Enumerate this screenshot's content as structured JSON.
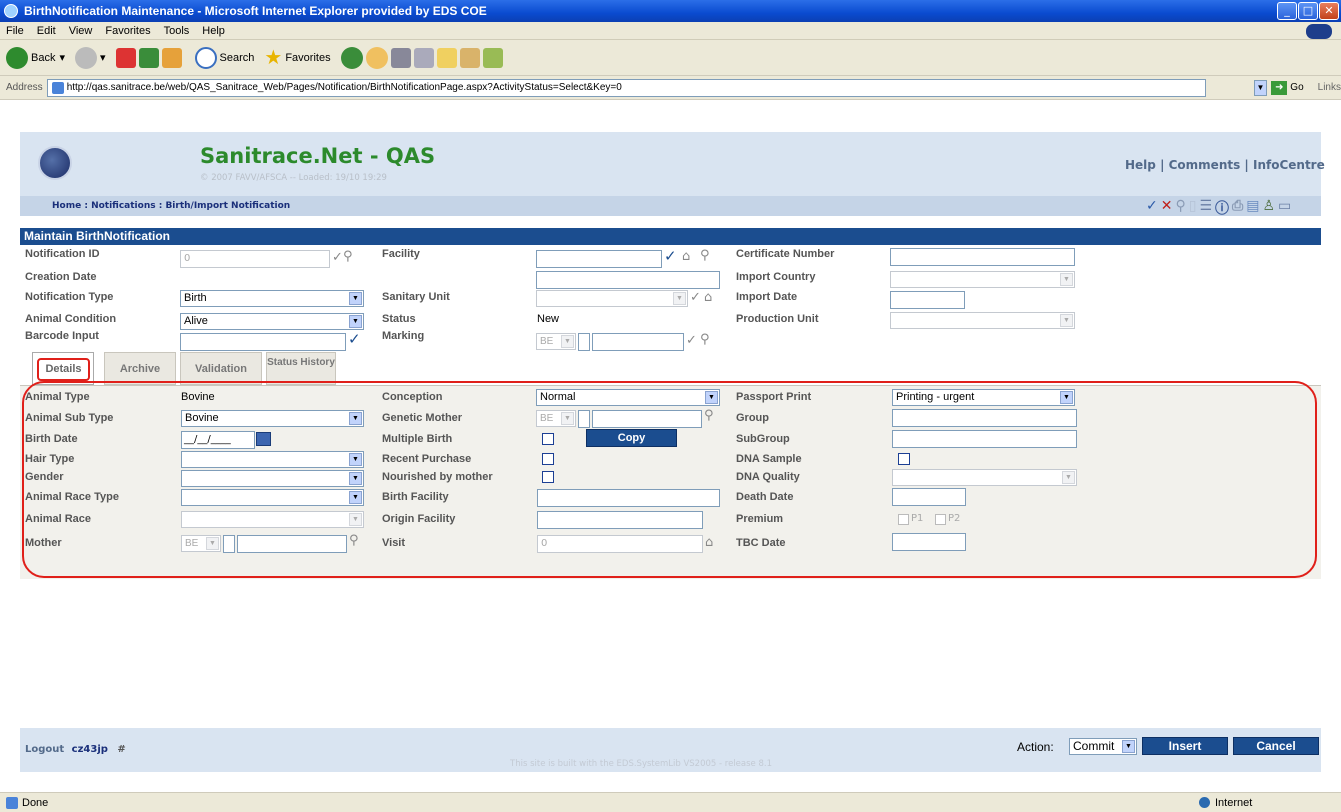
{
  "window": {
    "title": "BirthNotification Maintenance - Microsoft Internet Explorer provided by EDS COE"
  },
  "menu": [
    "File",
    "Edit",
    "View",
    "Favorites",
    "Tools",
    "Help"
  ],
  "toolbar": {
    "back": "Back",
    "search": "Search",
    "favorites": "Favorites"
  },
  "address": {
    "label": "Address",
    "url": "http://qas.sanitrace.be/web/QAS_Sanitrace_Web/Pages/Notification/BirthNotificationPage.aspx?ActivityStatus=Select&Key=0",
    "go": "Go",
    "links": "Links"
  },
  "header": {
    "title": "Sanitrace.Net - QAS",
    "subtitle": "© 2007 FAVV/AFSCA -- Loaded: 19/10 19:29",
    "links": "Help | Comments | InfoCentre"
  },
  "breadcrumb": "Home : Notifications : Birth/Import Notification",
  "section": "Maintain BirthNotification",
  "form": {
    "notification_id": {
      "label": "Notification ID",
      "value": "0"
    },
    "creation_date": {
      "label": "Creation Date"
    },
    "notification_type": {
      "label": "Notification Type",
      "value": "Birth"
    },
    "animal_condition": {
      "label": "Animal Condition",
      "value": "Alive"
    },
    "barcode_input": {
      "label": "Barcode Input"
    },
    "facility": {
      "label": "Facility"
    },
    "sanitary_unit": {
      "label": "Sanitary Unit"
    },
    "status": {
      "label": "Status",
      "value": "New"
    },
    "marking": {
      "label": "Marking",
      "country": "BE"
    },
    "certificate_number": {
      "label": "Certificate Number"
    },
    "import_country": {
      "label": "Import Country"
    },
    "import_date": {
      "label": "Import Date"
    },
    "production_unit": {
      "label": "Production Unit"
    }
  },
  "tabs": [
    "Details",
    "Archive",
    "Validation",
    "Status History"
  ],
  "details": {
    "animal_type": {
      "label": "Animal Type",
      "value": "Bovine"
    },
    "animal_sub_type": {
      "label": "Animal Sub Type",
      "value": "Bovine"
    },
    "birth_date": {
      "label": "Birth Date",
      "value": "__/__/____"
    },
    "hair_type": {
      "label": "Hair Type"
    },
    "gender": {
      "label": "Gender"
    },
    "animal_race_type": {
      "label": "Animal Race Type"
    },
    "animal_race": {
      "label": "Animal Race"
    },
    "mother": {
      "label": "Mother",
      "country": "BE"
    },
    "conception": {
      "label": "Conception",
      "value": "Normal"
    },
    "genetic_mother": {
      "label": "Genetic Mother",
      "country": "BE"
    },
    "multiple_birth": {
      "label": "Multiple Birth"
    },
    "copy_button": "Copy",
    "recent_purchase": {
      "label": "Recent Purchase"
    },
    "nourished_by_mother": {
      "label": "Nourished by mother"
    },
    "birth_facility": {
      "label": "Birth Facility"
    },
    "origin_facility": {
      "label": "Origin Facility"
    },
    "visit": {
      "label": "Visit",
      "value": "0"
    },
    "passport_print": {
      "label": "Passport Print",
      "value": "Printing - urgent"
    },
    "group": {
      "label": "Group"
    },
    "subgroup": {
      "label": "SubGroup"
    },
    "dna_sample": {
      "label": "DNA Sample"
    },
    "dna_quality": {
      "label": "DNA Quality"
    },
    "death_date": {
      "label": "Death Date"
    },
    "premium": {
      "label": "Premium",
      "p1": "P1",
      "p2": "P2"
    },
    "tbc_date": {
      "label": "TBC Date"
    }
  },
  "footer": {
    "logout": "Logout",
    "user": "cz43jp",
    "hash": "#",
    "action_label": "Action:",
    "action_value": "Commit",
    "insert": "Insert",
    "cancel": "Cancel",
    "built": "This site is built with the EDS.SystemLib VS2005 - release 8.1"
  },
  "statusbar": {
    "left": "Done",
    "right": "Internet"
  },
  "colors": {
    "accent": "#1b4d8f",
    "title_green": "#2c8a2c",
    "highlight_red": "#e0201a"
  }
}
